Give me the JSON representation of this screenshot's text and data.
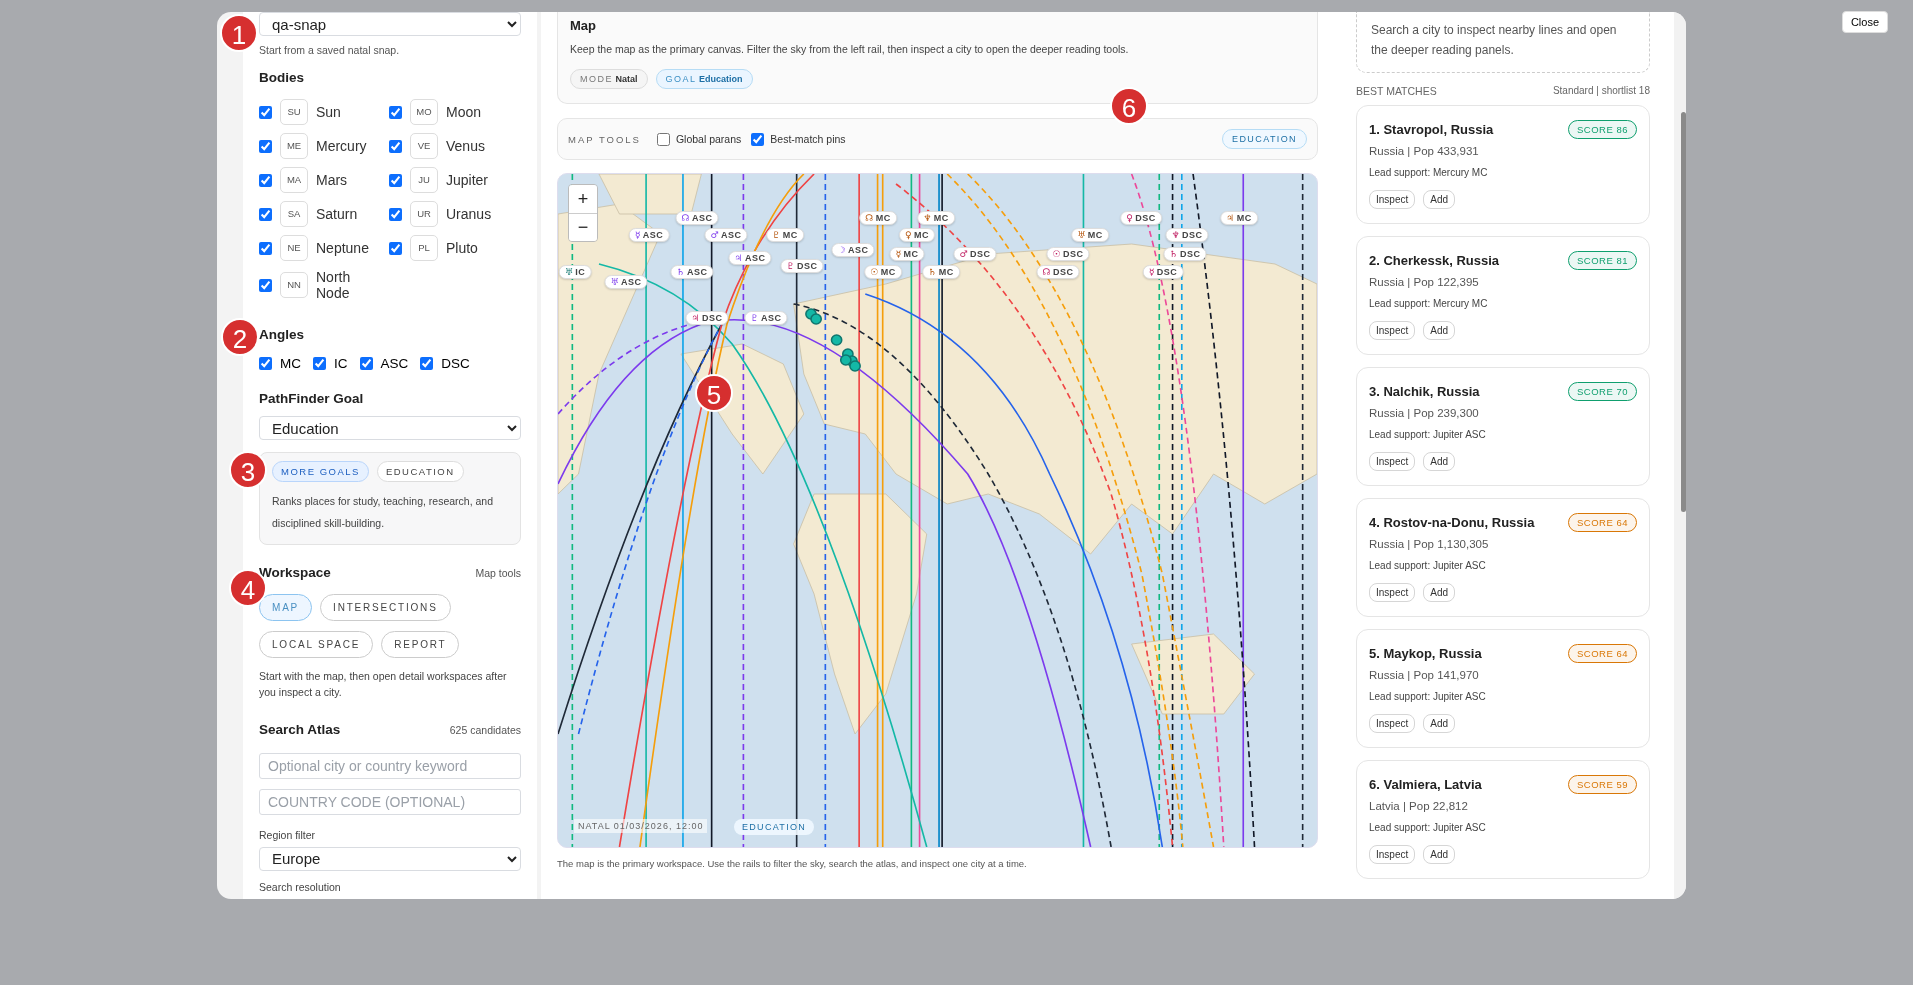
{
  "close_button": "Close",
  "left_rail": {
    "snapshot_select": "qa-snap",
    "snapshot_hint": "Start from a saved natal snap.",
    "bodies_heading": "Bodies",
    "bodies": [
      {
        "code": "SU",
        "name": "Sun",
        "checked": true
      },
      {
        "code": "MO",
        "name": "Moon",
        "checked": true
      },
      {
        "code": "ME",
        "name": "Mercury",
        "checked": true
      },
      {
        "code": "VE",
        "name": "Venus",
        "checked": true
      },
      {
        "code": "MA",
        "name": "Mars",
        "checked": true
      },
      {
        "code": "JU",
        "name": "Jupiter",
        "checked": true
      },
      {
        "code": "SA",
        "name": "Saturn",
        "checked": true
      },
      {
        "code": "UR",
        "name": "Uranus",
        "checked": true
      },
      {
        "code": "NE",
        "name": "Neptune",
        "checked": true
      },
      {
        "code": "PL",
        "name": "Pluto",
        "checked": true
      },
      {
        "code": "NN",
        "name": "North Node",
        "checked": true
      }
    ],
    "angles_heading": "Angles",
    "angles": [
      {
        "label": "MC",
        "checked": true
      },
      {
        "label": "IC",
        "checked": true
      },
      {
        "label": "ASC",
        "checked": true
      },
      {
        "label": "DSC",
        "checked": true
      }
    ],
    "goal_heading": "PathFinder Goal",
    "goal_select": "Education",
    "goal_tags": [
      {
        "label": "MORE GOALS",
        "selected": true
      },
      {
        "label": "EDUCATION",
        "selected": false
      }
    ],
    "goal_description": "Ranks places for study, teaching, research, and disciplined skill-building.",
    "workspace_heading": "Workspace",
    "workspace_link": "Map tools",
    "workspace_tabs": [
      {
        "label": "MAP",
        "selected": true
      },
      {
        "label": "INTERSECTIONS",
        "selected": false
      },
      {
        "label": "LOCAL SPACE",
        "selected": false
      },
      {
        "label": "REPORT",
        "selected": false
      }
    ],
    "workspace_hint": "Start with the map, then open detail workspaces after you inspect a city.",
    "search_heading": "Search Atlas",
    "candidates": "625 candidates",
    "keyword_placeholder": "Optional city or country keyword",
    "country_placeholder": "COUNTRY CODE (OPTIONAL)",
    "region_label": "Region filter",
    "region_select": "Europe",
    "resolution_label": "Search resolution"
  },
  "map_panel": {
    "title": "Map",
    "description": "Keep the map as the primary canvas. Filter the sky from the left rail, then inspect a city to open the deeper reading tools.",
    "chips": [
      {
        "key": "MODE",
        "value": "Natal",
        "selected": false
      },
      {
        "key": "GOAL",
        "value": "Education",
        "selected": true
      }
    ]
  },
  "map_tools": {
    "label": "MAP TOOLS",
    "toggles": [
      {
        "label": "Global parans",
        "checked": false
      },
      {
        "label": "Best-match pins",
        "checked": true
      }
    ],
    "badge": "EDUCATION"
  },
  "map": {
    "zoom_in": "+",
    "zoom_out": "−",
    "pins": [
      {
        "glyph": "☊",
        "label": "ASC"
      },
      {
        "glyph": "☿",
        "label": "ASC"
      },
      {
        "glyph": "♂",
        "label": "ASC"
      },
      {
        "glyph": "♇",
        "label": "MC"
      },
      {
        "glyph": "♅",
        "label": "IC"
      },
      {
        "glyph": "♅",
        "label": "ASC"
      },
      {
        "glyph": "♄",
        "label": "ASC"
      },
      {
        "glyph": "♃",
        "label": "ASC"
      },
      {
        "glyph": "♇",
        "label": "DSC"
      },
      {
        "glyph": "☽",
        "label": "ASC"
      },
      {
        "glyph": "☊",
        "label": "MC"
      },
      {
        "glyph": "♆",
        "label": "MC"
      },
      {
        "glyph": "♀",
        "label": "MC"
      },
      {
        "glyph": "☿",
        "label": "MC"
      },
      {
        "glyph": "☉",
        "label": "MC"
      },
      {
        "glyph": "♄",
        "label": "MC"
      },
      {
        "glyph": "♂",
        "label": "DSC"
      },
      {
        "glyph": "☉",
        "label": "DSC"
      },
      {
        "glyph": "☊",
        "label": "DSC"
      },
      {
        "glyph": "♅",
        "label": "MC"
      },
      {
        "glyph": "♀",
        "label": "DSC"
      },
      {
        "glyph": "♆",
        "label": "DSC"
      },
      {
        "glyph": "♄",
        "label": "DSC"
      },
      {
        "glyph": "☿",
        "label": "DSC"
      },
      {
        "glyph": "♃",
        "label": "MC"
      },
      {
        "glyph": "♃",
        "label": "DSC"
      },
      {
        "glyph": "♇",
        "label": "ASC"
      }
    ],
    "footer_date": "NATAL 01/03/2026, 12:00",
    "footer_badge": "EDUCATION"
  },
  "map_caption": "The map is the primary workspace. Use the rails to filter the sky, search the atlas, and inspect one city at a time.",
  "results": {
    "hint": "Search a city to inspect nearby lines and open the deeper reading panels.",
    "heading": "BEST MATCHES",
    "meta": "Standard | shortlist 18",
    "matches": [
      {
        "title": "1. Stavropol, Russia",
        "score": "SCORE 86",
        "color": "#0f9f6e",
        "info": "Russia | Pop 433,931",
        "lead": "Lead support: Mercury MC",
        "actions": [
          "Inspect",
          "Add"
        ]
      },
      {
        "title": "2. Cherkessk, Russia",
        "score": "SCORE 81",
        "color": "#0f9f6e",
        "info": "Russia | Pop 122,395",
        "lead": "Lead support: Mercury MC",
        "actions": [
          "Inspect",
          "Add"
        ]
      },
      {
        "title": "3. Nalchik, Russia",
        "score": "SCORE 70",
        "color": "#0f9f6e",
        "info": "Russia | Pop 239,300",
        "lead": "Lead support: Jupiter ASC",
        "actions": [
          "Inspect",
          "Add"
        ]
      },
      {
        "title": "4. Rostov-na-Donu, Russia",
        "score": "SCORE 64",
        "color": "#d97706",
        "info": "Russia | Pop 1,130,305",
        "lead": "Lead support: Jupiter ASC",
        "actions": [
          "Inspect",
          "Add"
        ]
      },
      {
        "title": "5. Maykop, Russia",
        "score": "SCORE 64",
        "color": "#d97706",
        "info": "Russia | Pop 141,970",
        "lead": "Lead support: Jupiter ASC",
        "actions": [
          "Inspect",
          "Add"
        ]
      },
      {
        "title": "6. Valmiera, Latvia",
        "score": "SCORE 59",
        "color": "#d97706",
        "info": "Latvia | Pop 22,812",
        "lead": "Lead support: Jupiter ASC",
        "actions": [
          "Inspect",
          "Add"
        ]
      }
    ]
  },
  "annotations": [
    "1",
    "2",
    "3",
    "4",
    "5",
    "6"
  ]
}
